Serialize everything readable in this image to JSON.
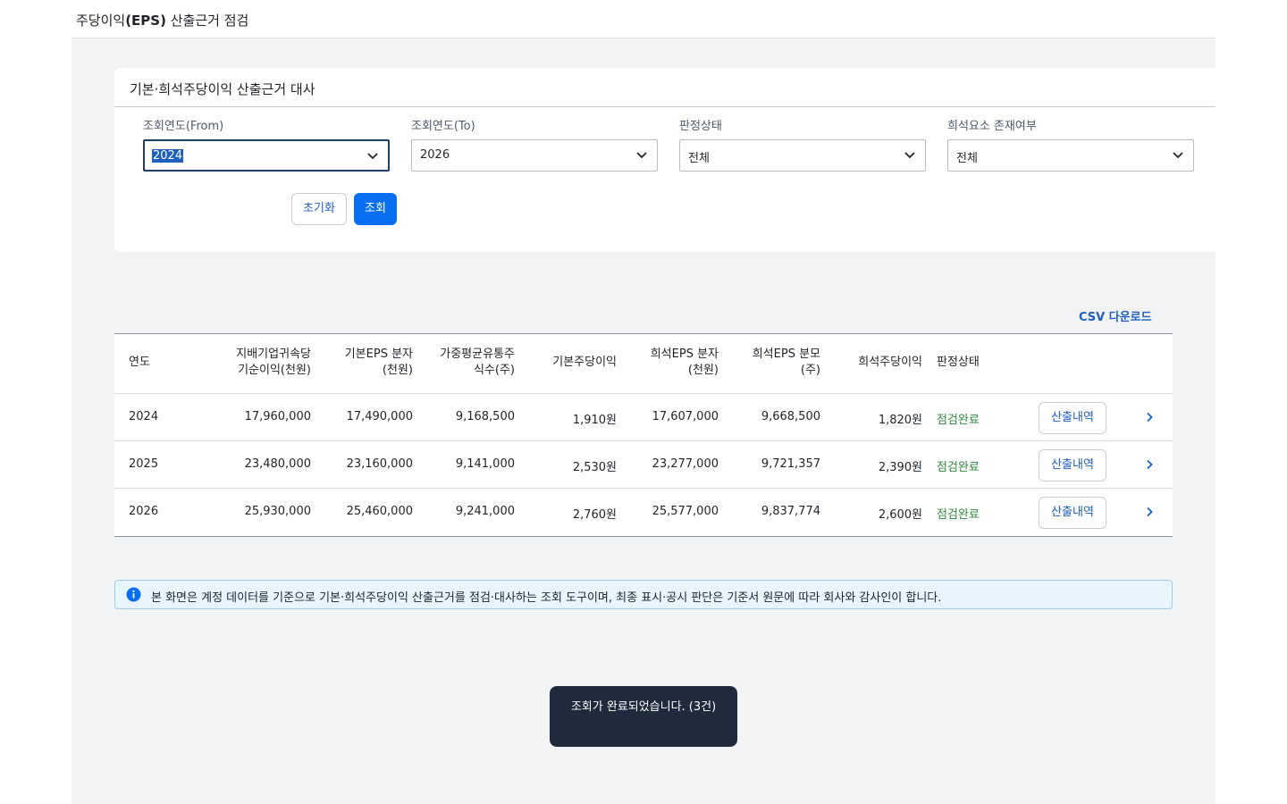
{
  "header": {
    "title_prefix": "주당이익",
    "title_bold": "(EPS)",
    "title_suffix": " 산출근거 점검"
  },
  "filter": {
    "card_title": "기본·희석주당이익 산출근거 대사",
    "fields": [
      {
        "label": "조회연도(From)",
        "value": "2024"
      },
      {
        "label": "조회연도(To)",
        "value": "2026"
      },
      {
        "label": "판정상태",
        "value": "전체"
      },
      {
        "label": "희석요소 존재여부",
        "value": "전체"
      }
    ],
    "reset_label": "초기화",
    "search_label": "조회"
  },
  "csv_label": "CSV 다운로드",
  "table": {
    "headers": {
      "year": "연도",
      "net_income_1": "지배기업귀속당",
      "net_income_2": "기순이익(천원)",
      "basic_num_1": "기본EPS 분자",
      "basic_num_2": "(천원)",
      "wavg_1": "가중평균유통주",
      "wavg_2": "식수(주)",
      "basic_eps": "기본주당이익",
      "diluted_num_1": "희석EPS 분자",
      "diluted_num_2": "(천원)",
      "diluted_den_1": "희석EPS 분모",
      "diluted_den_2": "(주)",
      "diluted_eps": "희석주당이익",
      "status": "판정상태"
    },
    "rows": [
      {
        "year": "2024",
        "net_income": "17,960,000",
        "basic_num": "17,490,000",
        "wavg": "9,168,500",
        "basic_eps": "1,910원",
        "diluted_num": "17,607,000",
        "diluted_den": "9,668,500",
        "diluted_eps": "1,820원",
        "status": "점검완료",
        "detail": "산출내역"
      },
      {
        "year": "2025",
        "net_income": "23,480,000",
        "basic_num": "23,160,000",
        "wavg": "9,141,000",
        "basic_eps": "2,530원",
        "diluted_num": "23,277,000",
        "diluted_den": "9,721,357",
        "diluted_eps": "2,390원",
        "status": "점검완료",
        "detail": "산출내역"
      },
      {
        "year": "2026",
        "net_income": "25,930,000",
        "basic_num": "25,460,000",
        "wavg": "9,241,000",
        "basic_eps": "2,760원",
        "diluted_num": "25,577,000",
        "diluted_den": "9,837,774",
        "diluted_eps": "2,600원",
        "status": "점검완료",
        "detail": "산출내역"
      }
    ]
  },
  "notice": "본 화면은 계정 데이터를 기준으로 기본·희석주당이익 산출근거를 점검·대사하는 조회 도구이며, 최종 표시·공시 판단은 기준서 원문에 따라 회사와 감사인이 합니다.",
  "toast": "조회가 완료되었습니다. (3건)",
  "colors": {
    "primary": "#0a6ef0",
    "link": "#1e5fbf",
    "status_ok": "#2f8a3b",
    "toast_bg": "#1f2a3c",
    "notice_bg": "#e8f5fd"
  }
}
